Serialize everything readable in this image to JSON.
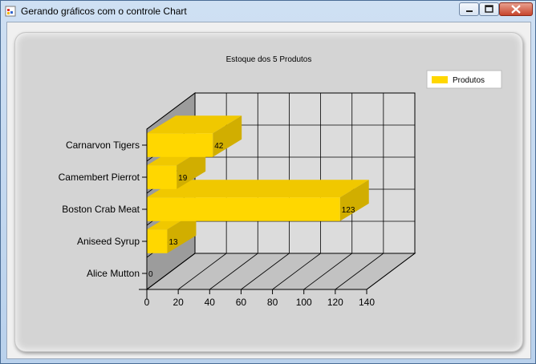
{
  "window": {
    "title": "Gerando gráficos com o controle Chart",
    "controls": {
      "minimize": "minimize",
      "maximize": "maximize",
      "close": "close"
    }
  },
  "chart_data": {
    "type": "bar",
    "orientation": "horizontal",
    "3d": true,
    "title": "Estoque dos 5 Produtos",
    "categories": [
      "Alice Mutton",
      "Aniseed Syrup",
      "Boston Crab Meat",
      "Camembert Pierrot",
      "Carnarvon Tigers"
    ],
    "series": [
      {
        "name": "Produtos",
        "values": [
          0,
          13,
          123,
          19,
          42
        ],
        "color": "#ffd700"
      }
    ],
    "data_labels": [
      "0",
      "13",
      "123",
      "19",
      "42"
    ],
    "xlim": [
      0,
      140
    ],
    "xticks": [
      "0",
      "20",
      "40",
      "60",
      "80",
      "100",
      "120",
      "140"
    ],
    "grid": true,
    "legend": {
      "position": "top-right",
      "entries": [
        "Produtos"
      ]
    }
  }
}
